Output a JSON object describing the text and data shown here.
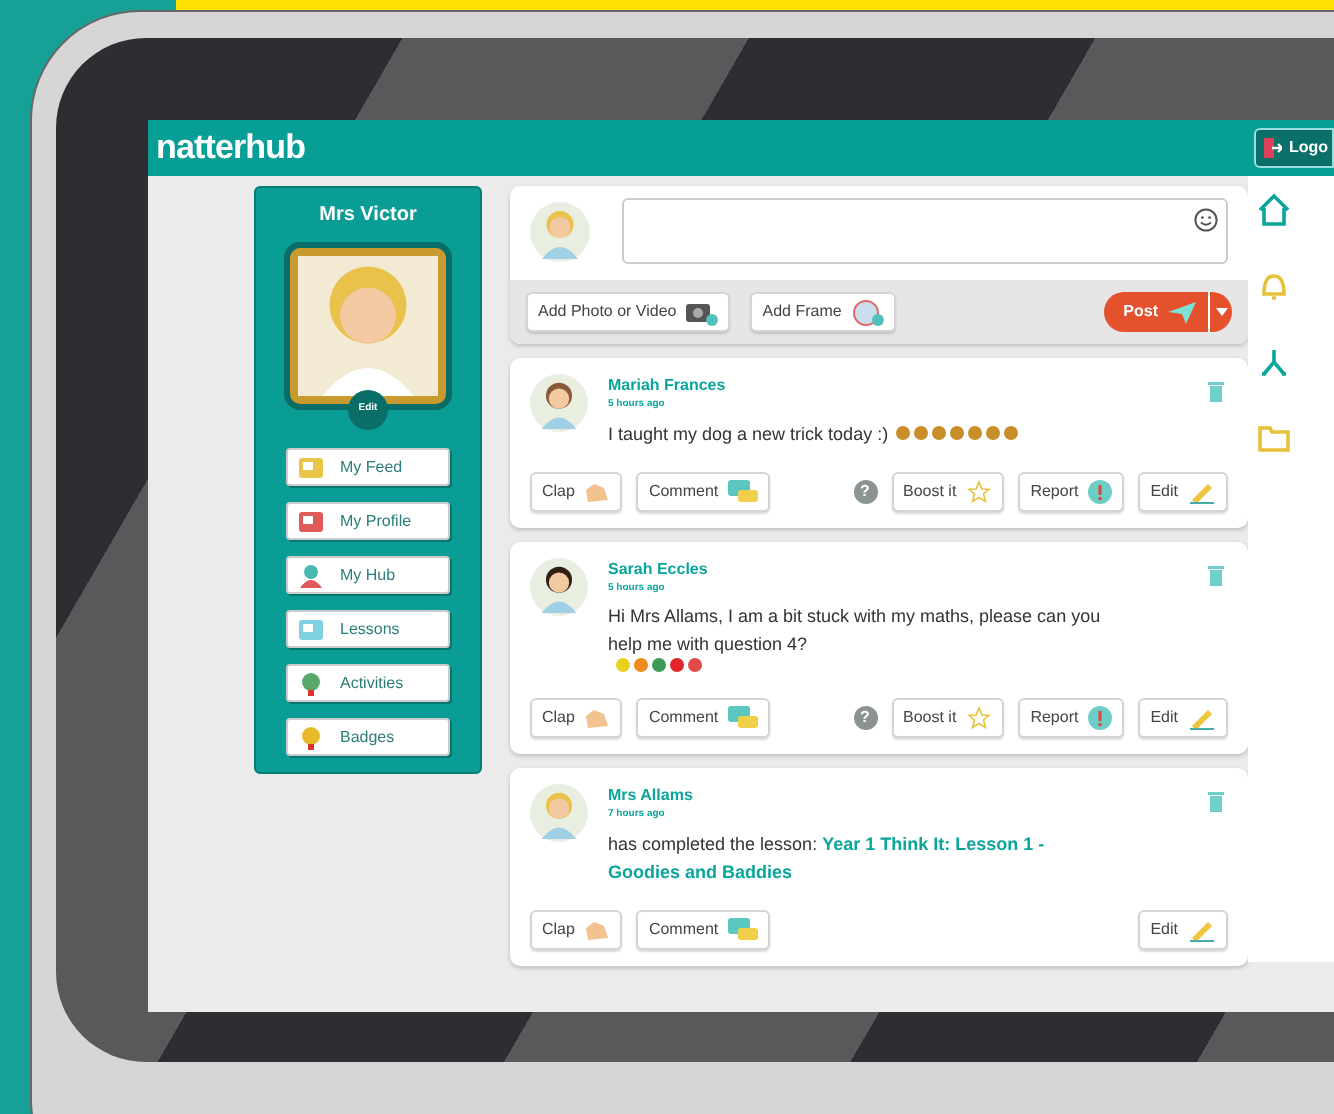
{
  "app": {
    "logo": "natterhub",
    "logout": "Logo"
  },
  "profile": {
    "name": "Mrs Victor",
    "edit": "Edit"
  },
  "nav": [
    {
      "label": "My Feed",
      "kind": "feed"
    },
    {
      "label": "My Profile",
      "kind": "profile"
    },
    {
      "label": "My Hub",
      "kind": "hub"
    },
    {
      "label": "Lessons",
      "kind": "lessons"
    },
    {
      "label": "Activities",
      "kind": "activities"
    },
    {
      "label": "Badges",
      "kind": "badges"
    }
  ],
  "composer": {
    "buttons": [
      {
        "label": "Add Photo or Video",
        "kind": "photo"
      },
      {
        "label": "Add Frame",
        "kind": "frame"
      }
    ],
    "post": "Post"
  },
  "posts": [
    {
      "author": "Mariah Frances",
      "time": "5 hours ago",
      "text": "I taught my dog a new trick today :)",
      "stickers": [
        {
          "color": "#c98d2a"
        },
        {
          "color": "#c98d2a"
        },
        {
          "color": "#c98d2a"
        },
        {
          "color": "#c98d2a"
        },
        {
          "color": "#c98d2a"
        },
        {
          "color": "#c98d2a"
        },
        {
          "color": "#c98d2a"
        }
      ],
      "actions": [
        {
          "label": "Clap",
          "kind": "clap"
        },
        {
          "label": "Comment",
          "kind": "comment"
        }
      ],
      "help": "?",
      "tools": [
        {
          "label": "Boost it",
          "kind": "boost"
        },
        {
          "label": "Report",
          "kind": "report"
        },
        {
          "label": "Edit",
          "kind": "edit"
        }
      ]
    },
    {
      "author": "Sarah Eccles",
      "time": "5 hours ago",
      "text": "Hi Mrs Allams, I am a bit stuck with my maths, please can you help me with question 4?",
      "stickers": [
        {
          "color": "#e8d21d"
        },
        {
          "color": "#f08a1c"
        },
        {
          "color": "#3e9b57"
        },
        {
          "color": "#e0262b"
        },
        {
          "color": "#e24a4a"
        }
      ],
      "actions": [
        {
          "label": "Clap",
          "kind": "clap"
        },
        {
          "label": "Comment",
          "kind": "comment"
        }
      ],
      "help": "?",
      "tools": [
        {
          "label": "Boost it",
          "kind": "boost"
        },
        {
          "label": "Report",
          "kind": "report"
        },
        {
          "label": "Edit",
          "kind": "edit"
        }
      ]
    },
    {
      "author": "Mrs Allams",
      "time": "7 hours ago",
      "text": "has completed the lesson: **Year 1 Think It: Lesson 1 - Goodies and Baddies**",
      "actions": [
        {
          "label": "Clap",
          "kind": "clap"
        },
        {
          "label": "Comment",
          "kind": "comment"
        }
      ],
      "tools": [
        {
          "label": "Edit",
          "kind": "edit"
        }
      ]
    }
  ]
}
